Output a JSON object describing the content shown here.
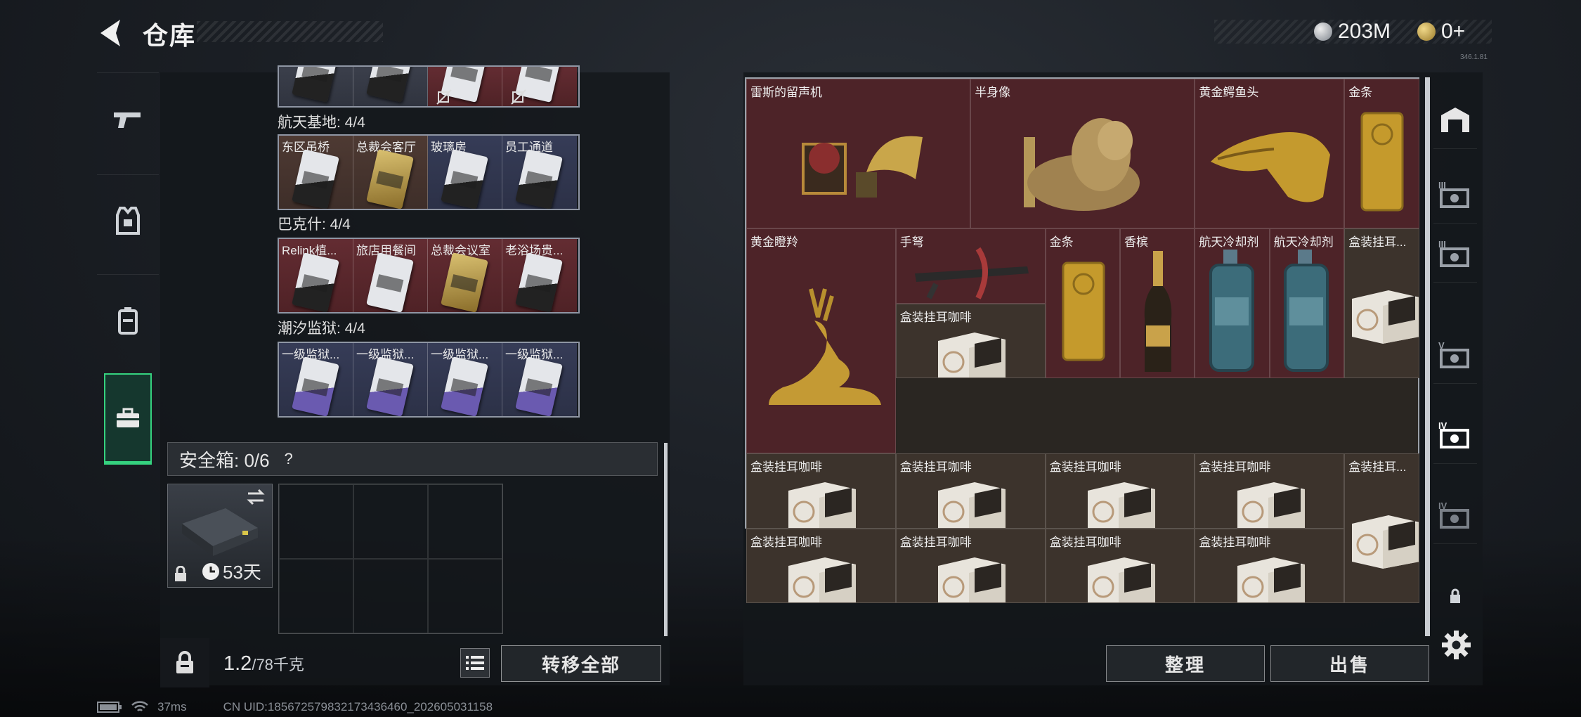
{
  "header": {
    "title": "仓库",
    "currency_1": "203M",
    "currency_2": "0+",
    "version": "346.1.81"
  },
  "left_sidebar": {
    "tabs": [
      {
        "icon": "pistol-icon"
      },
      {
        "icon": "armor-vest-icon"
      },
      {
        "icon": "backpack-icon"
      },
      {
        "icon": "briefcase-icon",
        "active": true
      }
    ]
  },
  "key_groups": [
    {
      "label": "",
      "cards": [
        {
          "name": "",
          "color": "gray"
        },
        {
          "name": "",
          "color": "gray"
        },
        {
          "name": "",
          "color": "red",
          "locked": true
        },
        {
          "name": "",
          "color": "red",
          "locked": true
        }
      ]
    },
    {
      "label": "航天基地: 4/4",
      "cards": [
        {
          "name": "东区吊桥",
          "color": "brown"
        },
        {
          "name": "总裁会客厅",
          "color": "brown"
        },
        {
          "name": "玻璃房",
          "color": "blue"
        },
        {
          "name": "员工通道",
          "color": "blue"
        }
      ]
    },
    {
      "label": "巴克什: 4/4",
      "cards": [
        {
          "name": "Relink植...",
          "color": "red"
        },
        {
          "name": "旅店用餐间",
          "color": "red"
        },
        {
          "name": "总裁会议室",
          "color": "red"
        },
        {
          "name": "老浴场贵...",
          "color": "red"
        }
      ]
    },
    {
      "label": "潮汐监狱: 4/4",
      "cards": [
        {
          "name": "一级监狱...",
          "color": "blue"
        },
        {
          "name": "一级监狱...",
          "color": "blue"
        },
        {
          "name": "一级监狱...",
          "color": "blue"
        },
        {
          "name": "一级监狱...",
          "color": "blue"
        }
      ]
    }
  ],
  "safe_box": {
    "label": "安全箱: 0/6",
    "help": "?",
    "days": "53天"
  },
  "weight": {
    "current": "1.2",
    "max": "/78千克"
  },
  "buttons": {
    "transfer_all": "转移全部",
    "sort": "整理",
    "sell": "出售"
  },
  "items": [
    {
      "name": "雷斯的留声机",
      "color": "r",
      "art": "gramophone"
    },
    {
      "name": "半身像",
      "color": "r",
      "art": "bust"
    },
    {
      "name": "黄金鳄鱼头",
      "color": "r",
      "art": "croc"
    },
    {
      "name": "金条",
      "color": "r",
      "art": "goldbar"
    },
    {
      "name": "黄金瞪羚",
      "color": "r",
      "art": "gazelle"
    },
    {
      "name": "手弩",
      "color": "r",
      "art": "crossbow"
    },
    {
      "name": "金条",
      "color": "r",
      "art": "goldbar"
    },
    {
      "name": "香槟",
      "color": "r",
      "art": "champagne"
    },
    {
      "name": "航天冷却剂",
      "color": "r",
      "art": "tank"
    },
    {
      "name": "航天冷却剂",
      "color": "r",
      "art": "tank"
    },
    {
      "name": "盒装挂耳...",
      "color": "b",
      "art": "box"
    },
    {
      "name": "盒装挂耳咖啡",
      "color": "b",
      "art": "box"
    },
    {
      "name": "盒装挂耳咖啡",
      "color": "b",
      "art": "box"
    },
    {
      "name": "盒装挂耳咖啡",
      "color": "b",
      "art": "box"
    },
    {
      "name": "盒装挂耳咖啡",
      "color": "b",
      "art": "box"
    },
    {
      "name": "盒装挂耳咖啡",
      "color": "b",
      "art": "box"
    },
    {
      "name": "盒装挂耳...",
      "color": "b",
      "art": "box"
    },
    {
      "name": "盒装挂耳咖啡",
      "color": "b",
      "art": "box"
    },
    {
      "name": "盒装挂耳咖啡",
      "color": "b",
      "art": "box"
    },
    {
      "name": "盒装挂耳咖啡",
      "color": "b",
      "art": "box"
    },
    {
      "name": "盒装挂耳咖啡",
      "color": "b",
      "art": "box"
    }
  ],
  "right_tabs": [
    {
      "icon": "warehouse-icon"
    },
    {
      "icon": "storage-iii-icon",
      "label": "III"
    },
    {
      "icon": "storage-iii-icon",
      "label": "III"
    },
    {
      "icon": "storage-v-icon",
      "label": "V"
    },
    {
      "icon": "storage-iv-icon",
      "label": "IV",
      "active": true
    },
    {
      "icon": "storage-iv-icon",
      "label": "IV"
    },
    {
      "icon": "lock-icon"
    }
  ],
  "status": {
    "ping": "37ms",
    "uid": "CN UID:18567257983217343646​0_202605031158"
  },
  "colors": {
    "accent": "#35d27f",
    "red_rarity": "#4d2328",
    "gold": "#c9a64a"
  }
}
